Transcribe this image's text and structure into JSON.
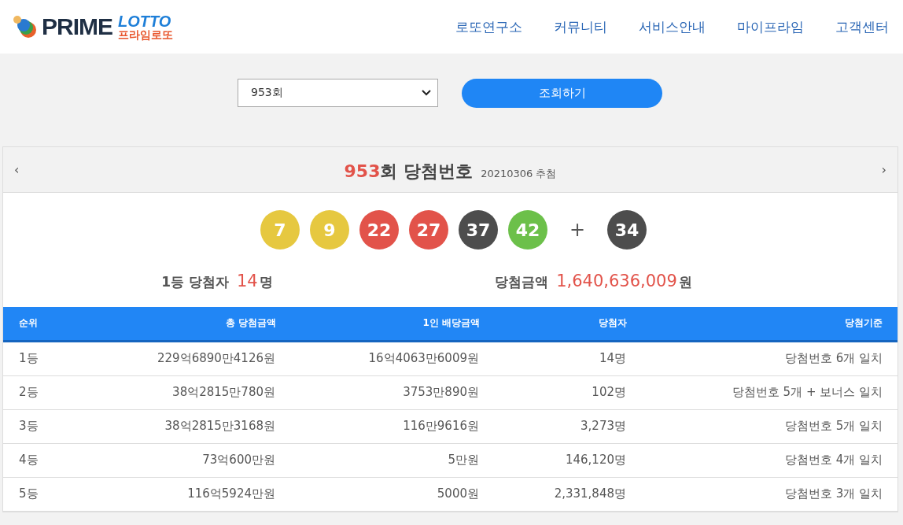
{
  "logo": {
    "wordmark": "PRIME",
    "lotto": "LOTTO",
    "korean": "프라임로또"
  },
  "nav": [
    {
      "label": "로또연구소"
    },
    {
      "label": "커뮤니티"
    },
    {
      "label": "서비스안내"
    },
    {
      "label": "마이프라임"
    },
    {
      "label": "고객센터"
    }
  ],
  "search": {
    "select_value": "953회",
    "button": "조회하기"
  },
  "draw": {
    "prev": "‹",
    "next": "›",
    "round": "953",
    "title_suffix": "회 당첨번호",
    "date": "20210306 추첨",
    "balls": [
      {
        "number": "7",
        "color": "#e6c840"
      },
      {
        "number": "9",
        "color": "#e6c840"
      },
      {
        "number": "22",
        "color": "#e2534a"
      },
      {
        "number": "27",
        "color": "#e2534a"
      },
      {
        "number": "37",
        "color": "#4d4d4d"
      },
      {
        "number": "42",
        "color": "#6cc04a"
      }
    ],
    "plus": "+",
    "bonus": {
      "number": "34",
      "color": "#4d4d4d"
    },
    "winners_label": "1등 당첨자",
    "winners_count": "14",
    "winners_unit": "명",
    "amount_label": "당첨금액",
    "amount": "1,640,636,009",
    "amount_unit": "원"
  },
  "table": {
    "columns": [
      "순위",
      "총 당첨금액",
      "1인 배당금액",
      "당첨자",
      "당첨기준"
    ],
    "rows": [
      [
        "1등",
        "229억6890만4126원",
        "16억4063만6009원",
        "14명",
        "당첨번호 6개 일치"
      ],
      [
        "2등",
        "38억2815만780원",
        "3753만890원",
        "102명",
        "당첨번호 5개 + 보너스 일치"
      ],
      [
        "3등",
        "38억2815만3168원",
        "116만9616원",
        "3,273명",
        "당첨번호 5개 일치"
      ],
      [
        "4등",
        "73억600만원",
        "5만원",
        "146,120명",
        "당첨번호 4개 일치"
      ],
      [
        "5등",
        "116억5924만원",
        "5000원",
        "2,331,848명",
        "당첨번호 3개 일치"
      ]
    ]
  }
}
